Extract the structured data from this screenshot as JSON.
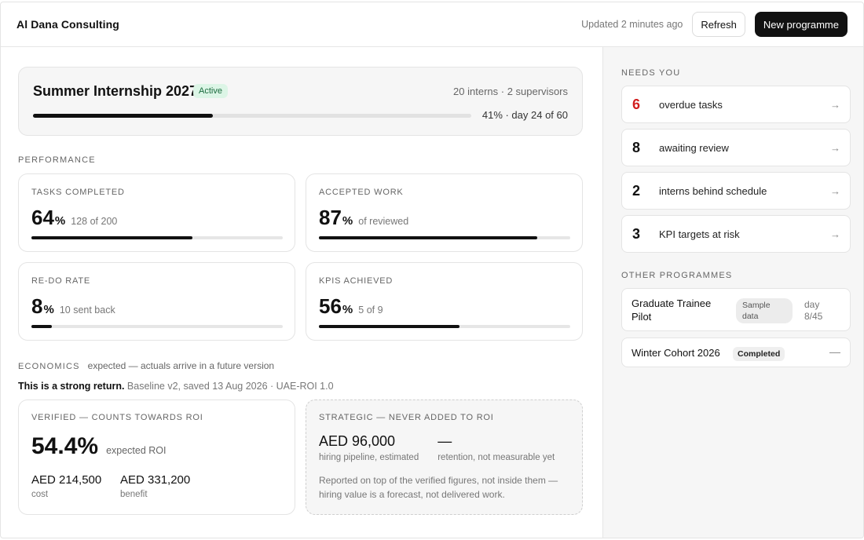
{
  "header": {
    "brand": "Al Dana Consulting",
    "updated": "Updated 2 minutes ago",
    "refresh_label": "Refresh",
    "new_programme_label": "New programme"
  },
  "programme": {
    "title": "Summer Internship 2027",
    "status": "Active",
    "meta": "20 interns · 2 supervisors",
    "progress_text": "41% · day 24 of 60",
    "progress_percent": 41
  },
  "performance": {
    "section_label": "PERFORMANCE",
    "metrics": [
      {
        "label": "TASKS COMPLETED",
        "value": "64",
        "unit": "%",
        "sub": "128 of 200",
        "fill_percent": 64
      },
      {
        "label": "ACCEPTED WORK",
        "value": "87",
        "unit": "%",
        "sub": "of reviewed",
        "fill_percent": 87
      },
      {
        "label": "RE-DO RATE",
        "value": "8",
        "unit": "%",
        "sub": "10 sent back",
        "fill_percent": 8
      },
      {
        "label": "KPIS ACHIEVED",
        "value": "56",
        "unit": "%",
        "sub": "5 of 9",
        "fill_percent": 56
      }
    ]
  },
  "economics": {
    "section_label": "ECONOMICS",
    "note": "expected — actuals arrive in a future version",
    "summary_bold": "This is a strong return.",
    "summary_rest": " Baseline v2, saved 13 Aug 2026 · UAE-ROI 1.0",
    "verified": {
      "label": "VERIFIED — COUNTS TOWARDS ROI",
      "roi": "54.4%",
      "roi_sub": "expected ROI",
      "cost_value": "AED 214,500",
      "cost_label": "cost",
      "benefit_value": "AED 331,200",
      "benefit_label": "benefit"
    },
    "strategic": {
      "label": "STRATEGIC — NEVER ADDED TO ROI",
      "pipeline_value": "AED 96,000",
      "pipeline_label": "hiring pipeline, estimated",
      "retention_value": "—",
      "retention_label": "retention, not measurable yet",
      "note": "Reported on top of the verified figures, not inside them — hiring value is a forecast, not delivered work."
    }
  },
  "needs_you": {
    "section_label": "NEEDS YOU",
    "items": [
      {
        "count": "6",
        "label": "overdue tasks",
        "arrow": "→",
        "color": "#d11e1e"
      },
      {
        "count": "8",
        "label": "awaiting review",
        "arrow": "→"
      },
      {
        "count": "2",
        "label": "interns behind schedule",
        "arrow": "→"
      },
      {
        "count": "3",
        "label": "KPI targets at risk",
        "arrow": "→"
      }
    ]
  },
  "other_programmes": {
    "section_label": "OTHER PROGRAMMES",
    "items": [
      {
        "name": "Graduate Trainee Pilot",
        "badge": "Sample data",
        "day": "day 8/45"
      },
      {
        "name": "Winter Cohort 2026",
        "badge": "Completed",
        "day": "—"
      }
    ]
  }
}
